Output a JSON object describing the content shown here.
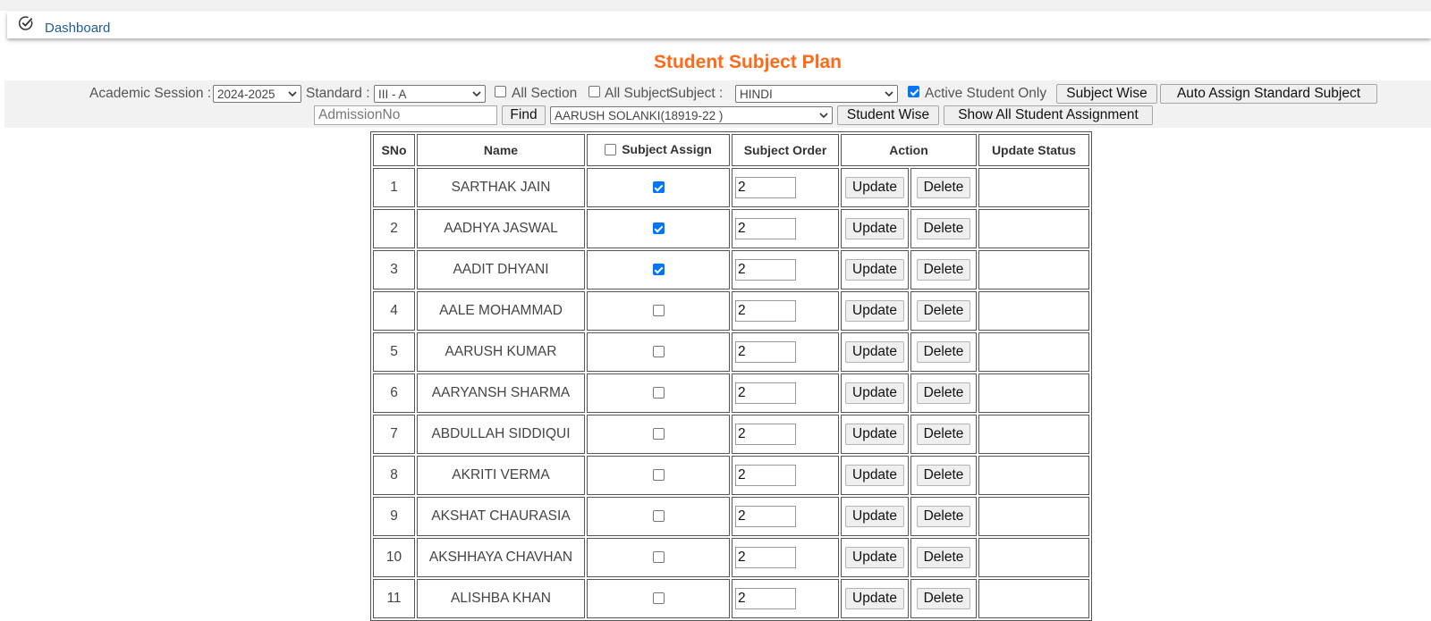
{
  "breadcrumb": {
    "icon": "check-circle-icon",
    "label": "Dashboard"
  },
  "page_title": "Student Subject Plan",
  "filters": {
    "academic_session_label": "Academic Session :",
    "academic_session_value": "2024-2025",
    "standard_label": "Standard :",
    "standard_value": "III - A",
    "all_section_label": "All Section",
    "all_section_checked": false,
    "all_subject_label": "All Subject",
    "all_subject_checked": false,
    "subject_label": "Subject :",
    "subject_value": "HINDI",
    "active_student_label": "Active Student Only",
    "active_student_checked": true,
    "subject_wise_button": "Subject Wise",
    "auto_assign_button": "Auto Assign Standard  Subject",
    "admission_placeholder": "AdmissionNo",
    "find_button": "Find",
    "student_value": "AARUSH SOLANKI(18919-22 )",
    "student_wise_button": "Student Wise",
    "show_all_button": "Show All Student Assignment"
  },
  "table": {
    "headers": {
      "sno": "SNo",
      "name": "Name",
      "subject_assign": "Subject Assign",
      "subject_order": "Subject Order",
      "action": "Action",
      "update_status": "Update Status"
    },
    "update_label": "Update",
    "delete_label": "Delete",
    "rows": [
      {
        "sno": "1",
        "name": "SARTHAK JAIN",
        "assigned": true,
        "order": "2",
        "status": ""
      },
      {
        "sno": "2",
        "name": "AADHYA JASWAL",
        "assigned": true,
        "order": "2",
        "status": ""
      },
      {
        "sno": "3",
        "name": "AADIT DHYANI",
        "assigned": true,
        "order": "2",
        "status": ""
      },
      {
        "sno": "4",
        "name": "AALE MOHAMMAD",
        "assigned": false,
        "order": "2",
        "status": ""
      },
      {
        "sno": "5",
        "name": "AARUSH KUMAR",
        "assigned": false,
        "order": "2",
        "status": ""
      },
      {
        "sno": "6",
        "name": "AARYANSH SHARMA",
        "assigned": false,
        "order": "2",
        "status": ""
      },
      {
        "sno": "7",
        "name": "ABDULLAH SIDDIQUI",
        "assigned": false,
        "order": "2",
        "status": ""
      },
      {
        "sno": "8",
        "name": "AKRITI VERMA",
        "assigned": false,
        "order": "2",
        "status": ""
      },
      {
        "sno": "9",
        "name": "AKSHAT CHAURASIA",
        "assigned": false,
        "order": "2",
        "status": ""
      },
      {
        "sno": "10",
        "name": "AKSHHAYA CHAVHAN",
        "assigned": false,
        "order": "2",
        "status": ""
      },
      {
        "sno": "11",
        "name": "ALISHBA KHAN",
        "assigned": false,
        "order": "2",
        "status": ""
      }
    ]
  },
  "colors": {
    "title": "#ff6a1a",
    "link": "#1f5b99",
    "checkbox": "#0075ff",
    "panel": "#f2f2f2"
  }
}
